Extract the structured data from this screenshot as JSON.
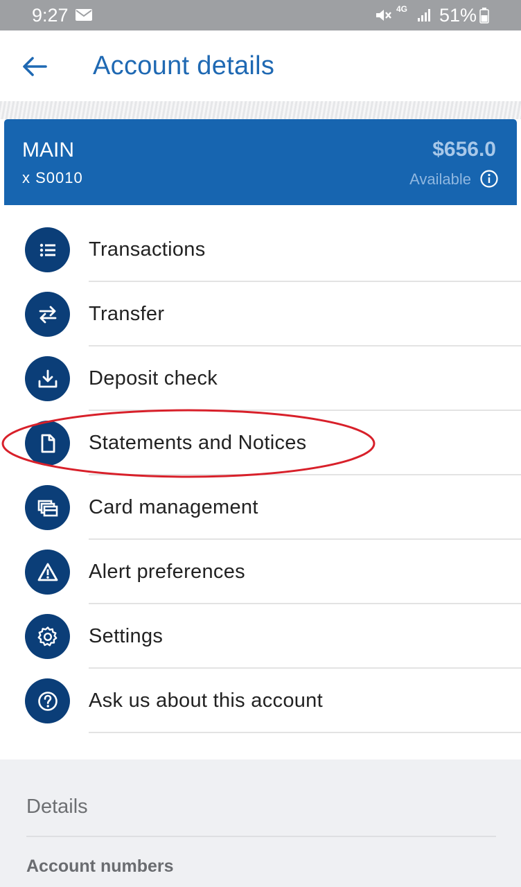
{
  "status_bar": {
    "time": "9:27",
    "network": "4G",
    "battery": "51%"
  },
  "header": {
    "title": "Account details"
  },
  "account": {
    "name": "MAIN",
    "number": "x  S0010",
    "balance": "$656.0",
    "balance_label": "Available"
  },
  "menu": {
    "items": [
      {
        "label": "Transactions",
        "icon": "list-icon"
      },
      {
        "label": "Transfer",
        "icon": "transfer-arrows-icon"
      },
      {
        "label": "Deposit check",
        "icon": "download-tray-icon"
      },
      {
        "label": "Statements and Notices",
        "icon": "document-icon"
      },
      {
        "label": "Card management",
        "icon": "cards-icon"
      },
      {
        "label": "Alert preferences",
        "icon": "warning-icon"
      },
      {
        "label": "Settings",
        "icon": "gear-icon"
      },
      {
        "label": "Ask us about this account",
        "icon": "question-icon"
      }
    ]
  },
  "details": {
    "header": "Details",
    "account_numbers": "Account numbers"
  },
  "colors": {
    "brand_blue": "#1765b0",
    "icon_navy": "#0b3e78",
    "title_blue": "#1f69b3",
    "highlight_red": "#d8202a"
  }
}
